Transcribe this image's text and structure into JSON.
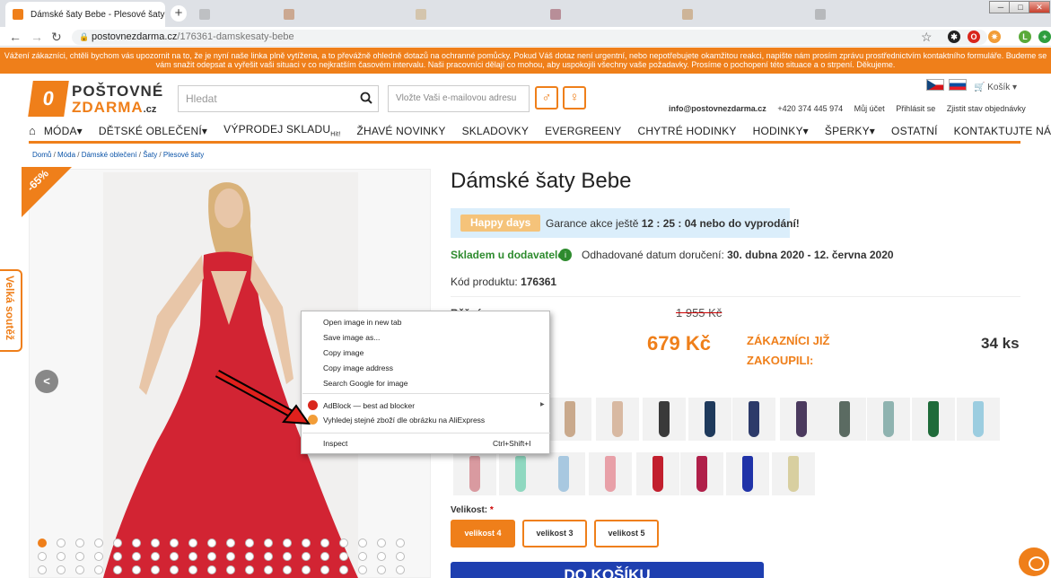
{
  "browser": {
    "active_tab": {
      "title": "Dámské šaty Bebe - Plesové šaty"
    },
    "url_domain": "postovnezdarma.cz",
    "url_path": "/176361-damskesaty-bebe",
    "window_controls": [
      "─",
      "□",
      "✕"
    ]
  },
  "notice": "Vážení zákazníci, chtěli bychom vás upozornit na to, že je nyní naše linka plně vytížena, a to převážně ohledně dotazů na ochranné pomůcky. Pokud Váš dotaz není urgentní, nebo nepotřebujete okamžitou reakci, napište nám prosím zprávu prostřednictvím kontaktního formuláře. Budeme se vám snažit odepsat a vyřešit vaši situaci v co nejkratším časovém intervalu. Naši pracovníci dělají co mohou, aby uspokojili všechny vaše požadavky. Prosíme o pochopení této situace a o strpení. Děkujeme.",
  "header": {
    "logo_mark": "0",
    "logo_line1": "POŠTOVNÉ",
    "logo_line2": "ZDARMA",
    "logo_tld": ".cz",
    "search_placeholder": "Hledat",
    "email_placeholder": "Vložte Vaši e-mailovou adresu",
    "gender_male": "♂",
    "gender_female": "♀",
    "cart_label": "Košík",
    "email": "info@postovnezdarma.cz",
    "phone": "+420 374 445 974",
    "account": "Můj účet",
    "login": "Přihlásit se",
    "order_status": "Zjistit stav objednávky"
  },
  "nav": {
    "items": [
      "MÓDA▾",
      "DĚTSKÉ OBLEČENÍ▾",
      "VÝPRODEJ SKLADU",
      "ŽHAVÉ NOVINKY",
      "SKLADOVKY",
      "EVERGREENY",
      "CHYTRÉ HODINKY",
      "HODINKY▾",
      "ŠPERKY▾",
      "OSTATNÍ",
      "KONTAKTUJTE NÁS"
    ],
    "hit_label": "Hit!"
  },
  "breadcrumb": [
    "Domů",
    "Móda",
    "Dámské oblečení",
    "Šaty",
    "Plesové šaty"
  ],
  "contest_tab": "Velká soutěž",
  "discount_badge": "-65%",
  "product": {
    "title": "Dámské šaty Bebe",
    "promo_tag": "Happy days",
    "promo_text_prefix": "Garance akce ještě",
    "promo_timer": "12 : 25 : 04",
    "promo_text_suffix": "nebo do vyprodání!",
    "stock": "Skladem u dodavatele",
    "delivery_label": "Odhadované datum doručení:",
    "delivery_dates": "30. dubna 2020 - 12. června 2020",
    "code_label": "Kód produktu:",
    "code": "176361",
    "old_price_label": "Běžná cena:",
    "old_price": "1 955 Kč",
    "new_price": "679 Kč",
    "bought_label": "ZÁKAZNÍCI JIŽ ZAKOUPILI:",
    "bought_count": "34 ks",
    "size_label": "Velikost:",
    "sizes": [
      "velikost 4",
      "velikost 3",
      "velikost 5"
    ],
    "add_to_cart": "DO KOŠÍKU"
  },
  "swatch_colors": [
    "#c9a98c",
    "#d8b9a2",
    "#3a3a3a",
    "#1f3a5c",
    "#2d3b6a",
    "#4b3a5e",
    "#5b6b62",
    "#8fb3b0",
    "#1f6b3a",
    "#b89a8a",
    "#9ccde0",
    "#d99aa0",
    "#8fd8c0",
    "#a8c8e0",
    "#e8a0a8",
    "#c21f2e",
    "#b0204a",
    "#2033a8",
    "#1a9ad6",
    "#e8d020",
    "#d8cfa0"
  ],
  "context_menu": {
    "items": [
      "Open image in new tab",
      "Save image as...",
      "Copy image",
      "Copy image address",
      "Search Google for image",
      "AdBlock — best ad blocker",
      "Vyhledej stejné zboží dle obrázku na AliExpress",
      "Inspect"
    ],
    "inspect_shortcut": "Ctrl+Shift+I",
    "submenu_arrow": "▶"
  },
  "colors": {
    "accent": "#ef7f1a",
    "stock_green": "#2e8b2e",
    "cart_blue": "#1e3fb0"
  }
}
